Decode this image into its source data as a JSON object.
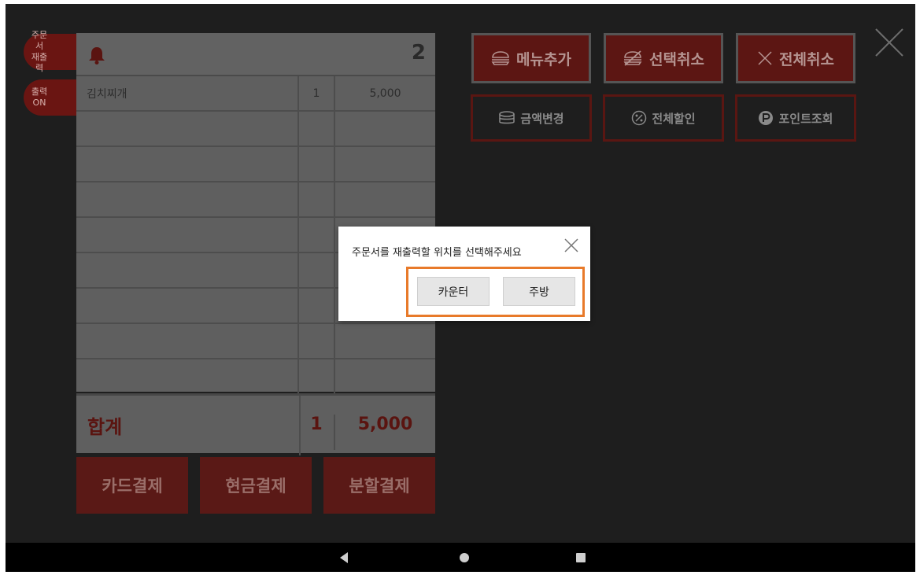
{
  "side_tabs": [
    {
      "line1": "주문서",
      "line2": "재출력"
    },
    {
      "line1": "출력",
      "line2": "ON"
    }
  ],
  "order": {
    "count": "2",
    "items": [
      {
        "name": "김치찌개",
        "qty": "1",
        "price": "5,000"
      },
      {
        "name": "",
        "qty": "",
        "price": ""
      },
      {
        "name": "",
        "qty": "",
        "price": ""
      },
      {
        "name": "",
        "qty": "",
        "price": ""
      },
      {
        "name": "",
        "qty": "",
        "price": ""
      },
      {
        "name": "",
        "qty": "",
        "price": ""
      },
      {
        "name": "",
        "qty": "",
        "price": ""
      },
      {
        "name": "",
        "qty": "",
        "price": ""
      },
      {
        "name": "",
        "qty": "",
        "price": ""
      }
    ],
    "total_label": "합계",
    "total_qty": "1",
    "total_sum": "5,000"
  },
  "payment": {
    "card": "카드결제",
    "cash": "현금결제",
    "split": "분할결제"
  },
  "actions": {
    "add_menu": "메뉴추가",
    "cancel_selected": "선택취소",
    "cancel_all": "전체취소",
    "change_amount": "금액변경",
    "discount_all": "전체할인",
    "point_lookup": "포인트조회"
  },
  "dialog": {
    "message": "주문서를 재출력할 위치를 선택해주세요",
    "counter": "카운터",
    "kitchen": "주방"
  },
  "colors": {
    "accent_dark_red": "#5c1613",
    "highlight_orange": "#e87a2a"
  }
}
